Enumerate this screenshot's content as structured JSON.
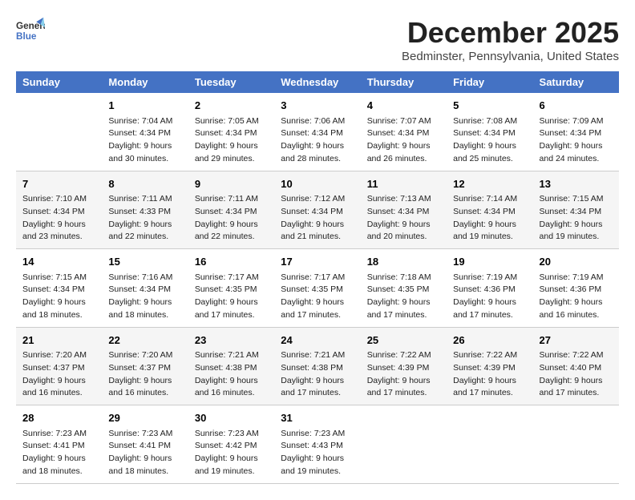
{
  "header": {
    "logo_line1": "General",
    "logo_line2": "Blue",
    "month": "December 2025",
    "location": "Bedminster, Pennsylvania, United States"
  },
  "days_of_week": [
    "Sunday",
    "Monday",
    "Tuesday",
    "Wednesday",
    "Thursday",
    "Friday",
    "Saturday"
  ],
  "weeks": [
    [
      {
        "day": "",
        "lines": []
      },
      {
        "day": "1",
        "lines": [
          "Sunrise: 7:04 AM",
          "Sunset: 4:34 PM",
          "Daylight: 9 hours",
          "and 30 minutes."
        ]
      },
      {
        "day": "2",
        "lines": [
          "Sunrise: 7:05 AM",
          "Sunset: 4:34 PM",
          "Daylight: 9 hours",
          "and 29 minutes."
        ]
      },
      {
        "day": "3",
        "lines": [
          "Sunrise: 7:06 AM",
          "Sunset: 4:34 PM",
          "Daylight: 9 hours",
          "and 28 minutes."
        ]
      },
      {
        "day": "4",
        "lines": [
          "Sunrise: 7:07 AM",
          "Sunset: 4:34 PM",
          "Daylight: 9 hours",
          "and 26 minutes."
        ]
      },
      {
        "day": "5",
        "lines": [
          "Sunrise: 7:08 AM",
          "Sunset: 4:34 PM",
          "Daylight: 9 hours",
          "and 25 minutes."
        ]
      },
      {
        "day": "6",
        "lines": [
          "Sunrise: 7:09 AM",
          "Sunset: 4:34 PM",
          "Daylight: 9 hours",
          "and 24 minutes."
        ]
      }
    ],
    [
      {
        "day": "7",
        "lines": [
          "Sunrise: 7:10 AM",
          "Sunset: 4:34 PM",
          "Daylight: 9 hours",
          "and 23 minutes."
        ]
      },
      {
        "day": "8",
        "lines": [
          "Sunrise: 7:11 AM",
          "Sunset: 4:33 PM",
          "Daylight: 9 hours",
          "and 22 minutes."
        ]
      },
      {
        "day": "9",
        "lines": [
          "Sunrise: 7:11 AM",
          "Sunset: 4:34 PM",
          "Daylight: 9 hours",
          "and 22 minutes."
        ]
      },
      {
        "day": "10",
        "lines": [
          "Sunrise: 7:12 AM",
          "Sunset: 4:34 PM",
          "Daylight: 9 hours",
          "and 21 minutes."
        ]
      },
      {
        "day": "11",
        "lines": [
          "Sunrise: 7:13 AM",
          "Sunset: 4:34 PM",
          "Daylight: 9 hours",
          "and 20 minutes."
        ]
      },
      {
        "day": "12",
        "lines": [
          "Sunrise: 7:14 AM",
          "Sunset: 4:34 PM",
          "Daylight: 9 hours",
          "and 19 minutes."
        ]
      },
      {
        "day": "13",
        "lines": [
          "Sunrise: 7:15 AM",
          "Sunset: 4:34 PM",
          "Daylight: 9 hours",
          "and 19 minutes."
        ]
      }
    ],
    [
      {
        "day": "14",
        "lines": [
          "Sunrise: 7:15 AM",
          "Sunset: 4:34 PM",
          "Daylight: 9 hours",
          "and 18 minutes."
        ]
      },
      {
        "day": "15",
        "lines": [
          "Sunrise: 7:16 AM",
          "Sunset: 4:34 PM",
          "Daylight: 9 hours",
          "and 18 minutes."
        ]
      },
      {
        "day": "16",
        "lines": [
          "Sunrise: 7:17 AM",
          "Sunset: 4:35 PM",
          "Daylight: 9 hours",
          "and 17 minutes."
        ]
      },
      {
        "day": "17",
        "lines": [
          "Sunrise: 7:17 AM",
          "Sunset: 4:35 PM",
          "Daylight: 9 hours",
          "and 17 minutes."
        ]
      },
      {
        "day": "18",
        "lines": [
          "Sunrise: 7:18 AM",
          "Sunset: 4:35 PM",
          "Daylight: 9 hours",
          "and 17 minutes."
        ]
      },
      {
        "day": "19",
        "lines": [
          "Sunrise: 7:19 AM",
          "Sunset: 4:36 PM",
          "Daylight: 9 hours",
          "and 17 minutes."
        ]
      },
      {
        "day": "20",
        "lines": [
          "Sunrise: 7:19 AM",
          "Sunset: 4:36 PM",
          "Daylight: 9 hours",
          "and 16 minutes."
        ]
      }
    ],
    [
      {
        "day": "21",
        "lines": [
          "Sunrise: 7:20 AM",
          "Sunset: 4:37 PM",
          "Daylight: 9 hours",
          "and 16 minutes."
        ]
      },
      {
        "day": "22",
        "lines": [
          "Sunrise: 7:20 AM",
          "Sunset: 4:37 PM",
          "Daylight: 9 hours",
          "and 16 minutes."
        ]
      },
      {
        "day": "23",
        "lines": [
          "Sunrise: 7:21 AM",
          "Sunset: 4:38 PM",
          "Daylight: 9 hours",
          "and 16 minutes."
        ]
      },
      {
        "day": "24",
        "lines": [
          "Sunrise: 7:21 AM",
          "Sunset: 4:38 PM",
          "Daylight: 9 hours",
          "and 17 minutes."
        ]
      },
      {
        "day": "25",
        "lines": [
          "Sunrise: 7:22 AM",
          "Sunset: 4:39 PM",
          "Daylight: 9 hours",
          "and 17 minutes."
        ]
      },
      {
        "day": "26",
        "lines": [
          "Sunrise: 7:22 AM",
          "Sunset: 4:39 PM",
          "Daylight: 9 hours",
          "and 17 minutes."
        ]
      },
      {
        "day": "27",
        "lines": [
          "Sunrise: 7:22 AM",
          "Sunset: 4:40 PM",
          "Daylight: 9 hours",
          "and 17 minutes."
        ]
      }
    ],
    [
      {
        "day": "28",
        "lines": [
          "Sunrise: 7:23 AM",
          "Sunset: 4:41 PM",
          "Daylight: 9 hours",
          "and 18 minutes."
        ]
      },
      {
        "day": "29",
        "lines": [
          "Sunrise: 7:23 AM",
          "Sunset: 4:41 PM",
          "Daylight: 9 hours",
          "and 18 minutes."
        ]
      },
      {
        "day": "30",
        "lines": [
          "Sunrise: 7:23 AM",
          "Sunset: 4:42 PM",
          "Daylight: 9 hours",
          "and 19 minutes."
        ]
      },
      {
        "day": "31",
        "lines": [
          "Sunrise: 7:23 AM",
          "Sunset: 4:43 PM",
          "Daylight: 9 hours",
          "and 19 minutes."
        ]
      },
      {
        "day": "",
        "lines": []
      },
      {
        "day": "",
        "lines": []
      },
      {
        "day": "",
        "lines": []
      }
    ]
  ]
}
